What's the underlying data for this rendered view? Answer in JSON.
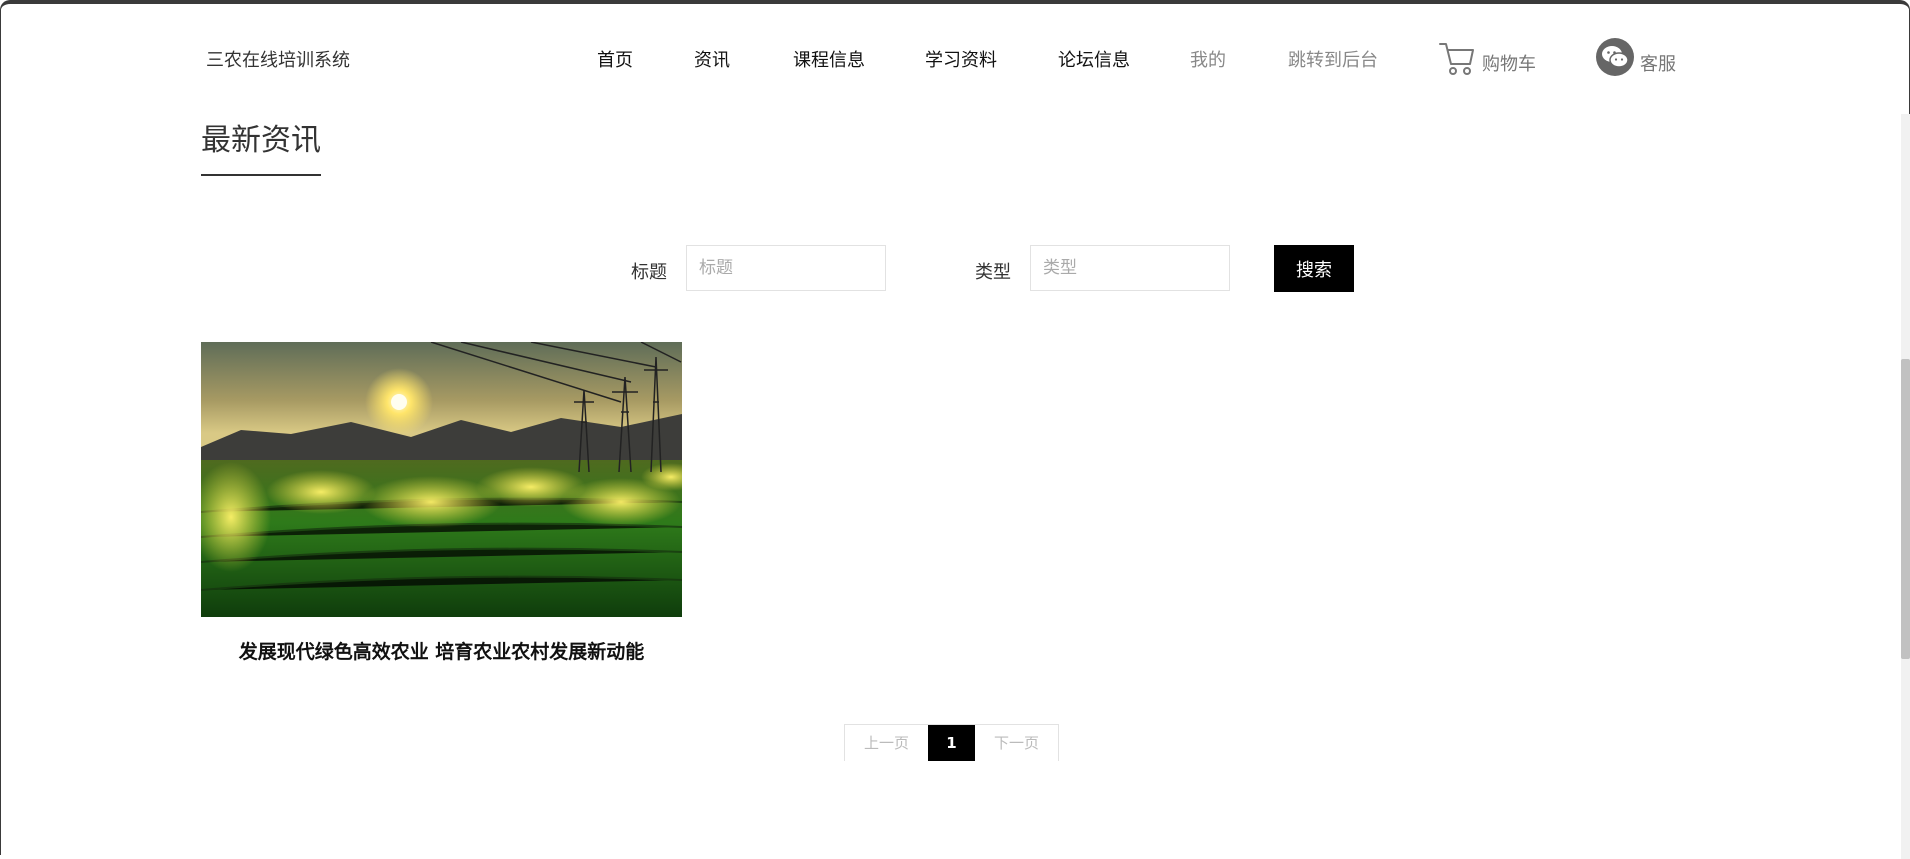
{
  "header": {
    "site_name": "三农在线培训系统",
    "nav": [
      {
        "label": "首页",
        "name": "nav-home"
      },
      {
        "label": "资讯",
        "name": "nav-news"
      },
      {
        "label": "课程信息",
        "name": "nav-courses"
      },
      {
        "label": "学习资料",
        "name": "nav-materials"
      },
      {
        "label": "论坛信息",
        "name": "nav-forum"
      },
      {
        "label": "我的",
        "name": "nav-mine"
      },
      {
        "label": "跳转到后台",
        "name": "nav-admin"
      }
    ],
    "cart_label": "购物车",
    "service_label": "客服",
    "icons": {
      "cart": "shopping-cart-icon",
      "service": "wechat-icon"
    }
  },
  "page": {
    "section_title": "最新资讯"
  },
  "search": {
    "title_label": "标题",
    "title_placeholder": "标题",
    "title_value": "",
    "type_label": "类型",
    "type_placeholder": "类型",
    "type_value": "",
    "button_label": "搜索"
  },
  "articles": [
    {
      "title": "发展现代绿色高效农业 培育农业农村发展新动能"
    }
  ],
  "pagination": {
    "prev_label": "上一页",
    "current_page": "1",
    "next_label": "下一页"
  },
  "colors": {
    "accent": "#000000",
    "text": "#333333",
    "muted": "#888888"
  }
}
